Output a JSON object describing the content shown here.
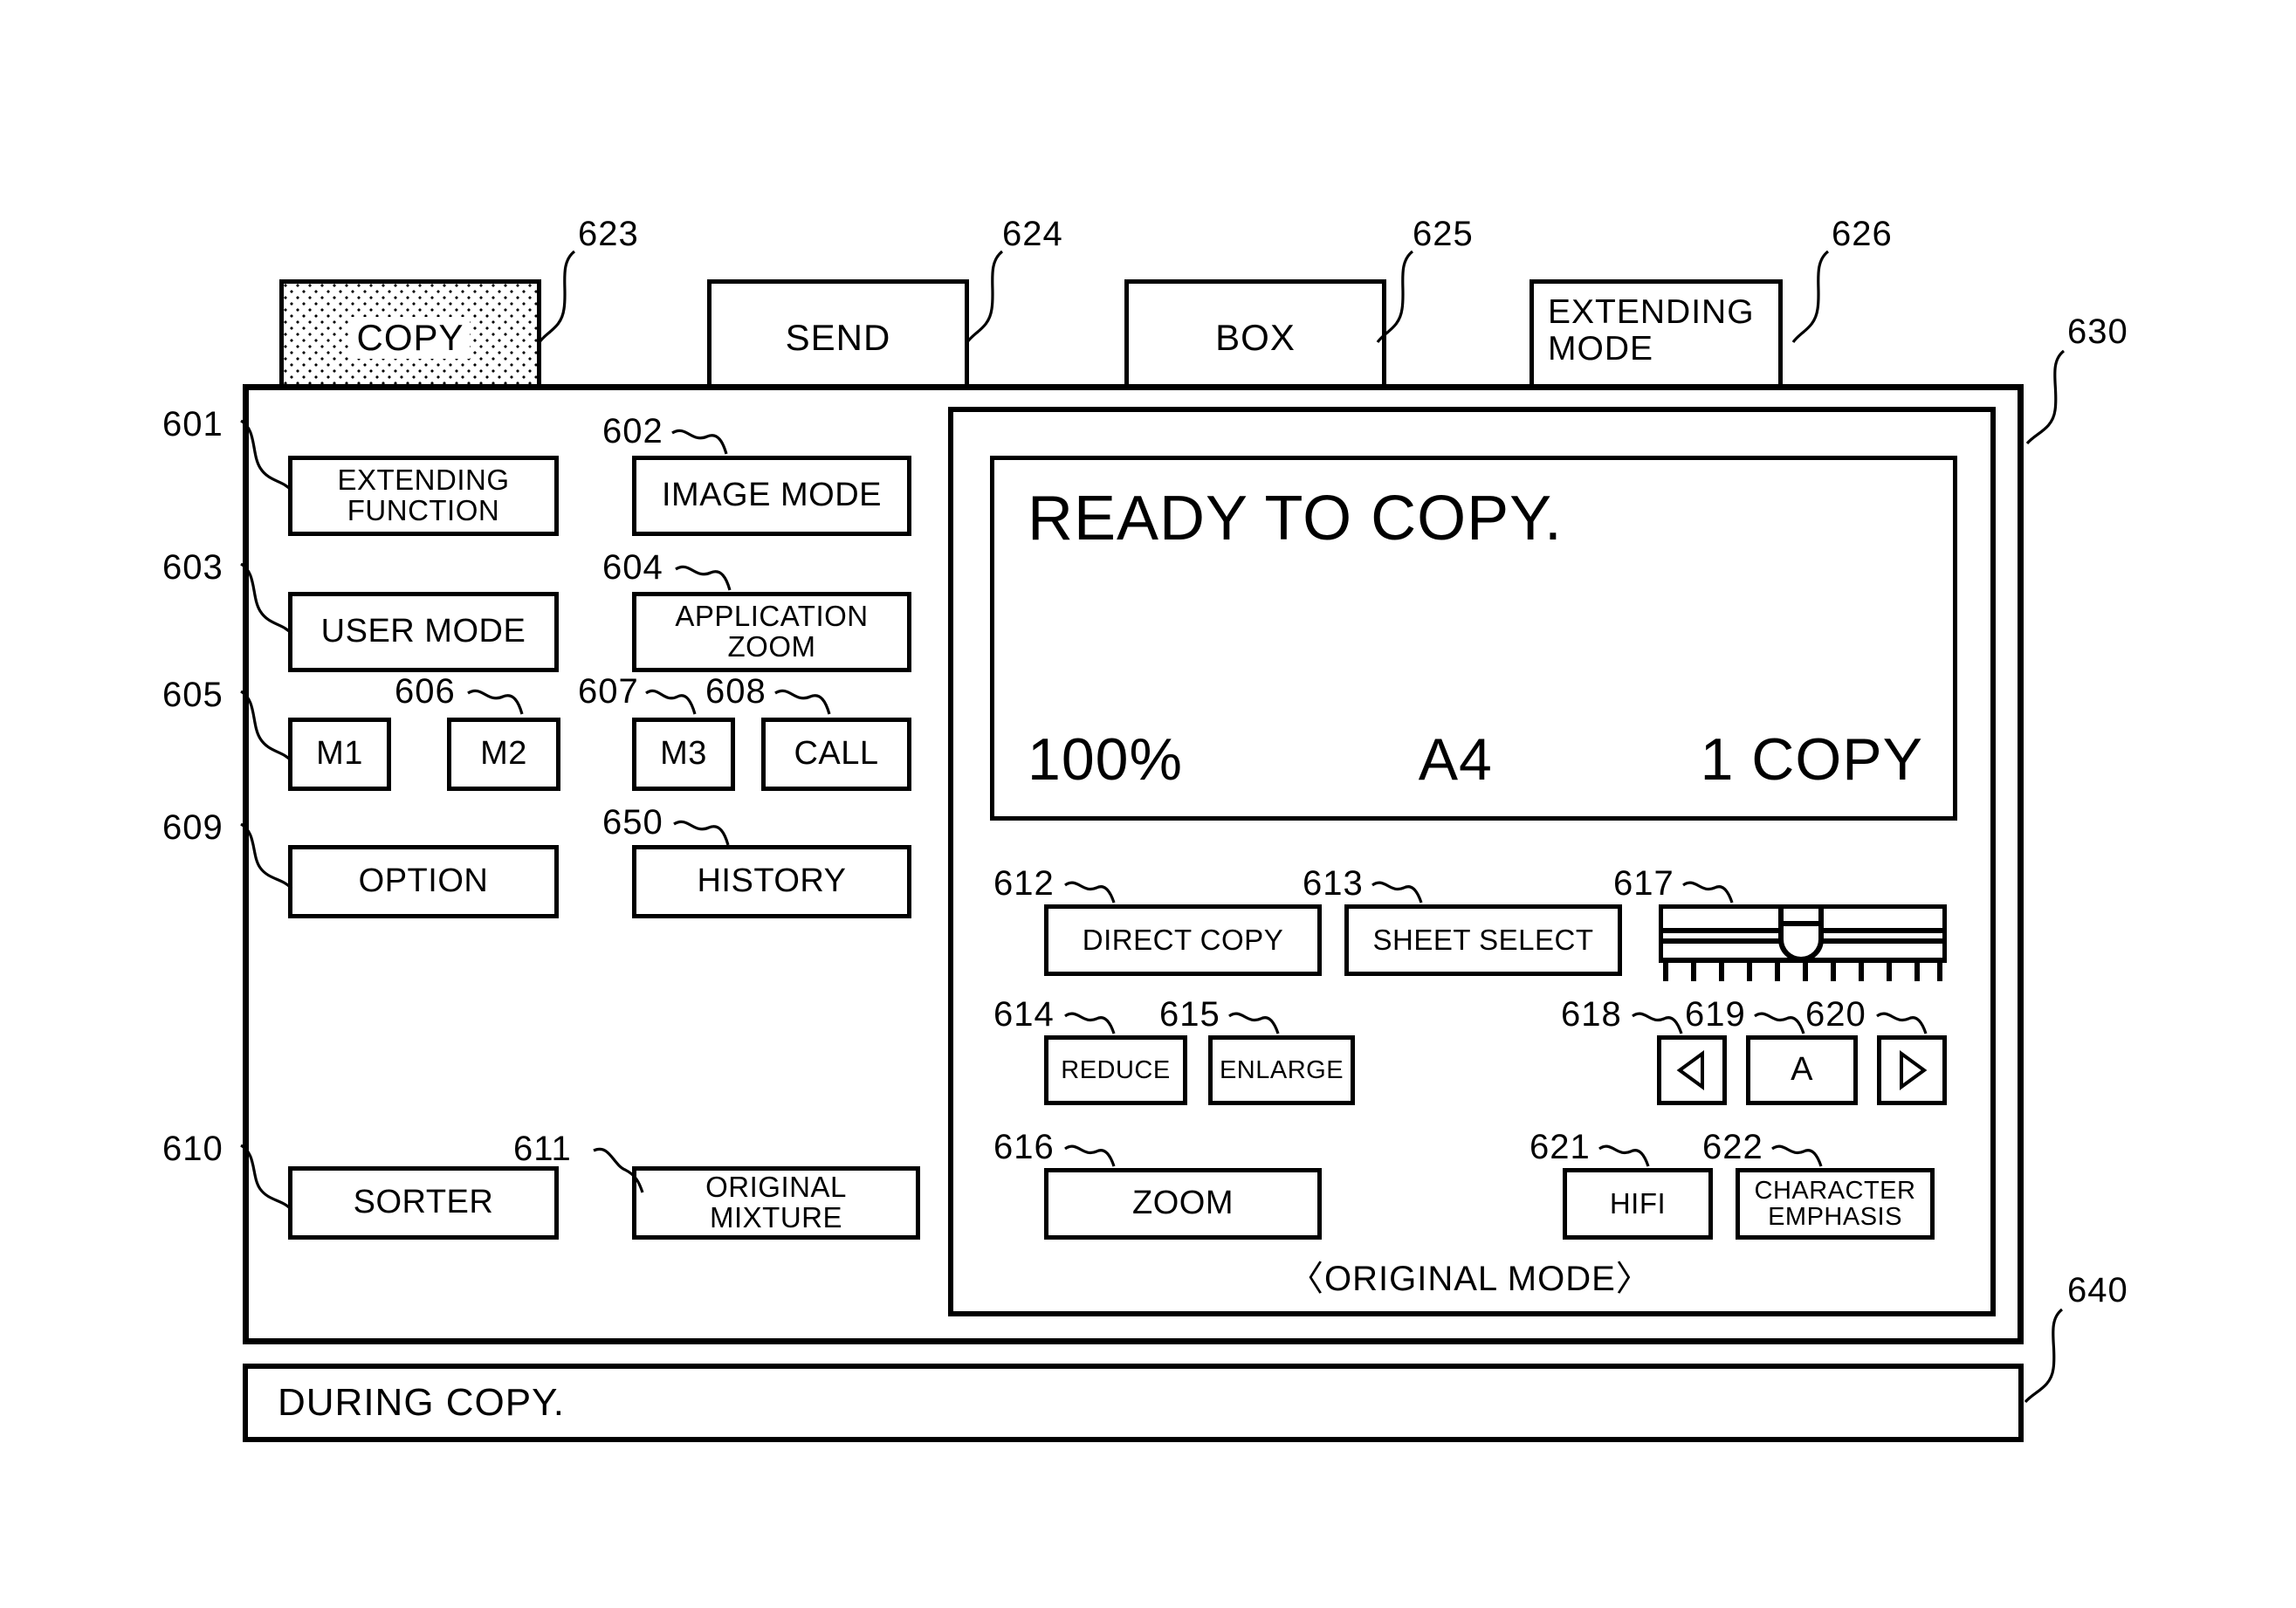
{
  "figure": {
    "kind": "copier-operation-panel-ui",
    "reference_numerals": {
      "extending_function": "601",
      "image_mode": "602",
      "user_mode": "603",
      "application_zoom": "604",
      "m1": "605",
      "m2": "606",
      "m3": "607",
      "call": "608",
      "option": "609",
      "sorter": "610",
      "original_mixture": "611",
      "direct_copy": "612",
      "sheet_select": "613",
      "reduce": "614",
      "enlarge": "615",
      "zoom": "616",
      "density_slider": "617",
      "arrow_left": "618",
      "auto_density": "619",
      "arrow_right": "620",
      "hifi": "621",
      "character_emphasis": "622",
      "tab_copy": "623",
      "tab_send": "624",
      "tab_box": "625",
      "tab_extending_mode": "626",
      "main_panel": "630",
      "status_bar": "640",
      "history": "650"
    }
  },
  "tabs": [
    {
      "id": "copy",
      "label": "COPY",
      "selected": true,
      "ref": "623"
    },
    {
      "id": "send",
      "label": "SEND",
      "selected": false,
      "ref": "624"
    },
    {
      "id": "box",
      "label": "BOX",
      "selected": false,
      "ref": "625"
    },
    {
      "id": "extending-mode",
      "label_line1": "EXTENDING",
      "label_line2": "MODE",
      "selected": false,
      "ref": "626"
    }
  ],
  "left_panel": {
    "buttons": [
      {
        "id": "extending-function",
        "line1": "EXTENDING",
        "line2": "FUNCTION",
        "ref": "601"
      },
      {
        "id": "image-mode",
        "label": "IMAGE MODE",
        "ref": "602"
      },
      {
        "id": "user-mode",
        "label": "USER MODE",
        "ref": "603"
      },
      {
        "id": "application-zoom",
        "label": "APPLICATION ZOOM",
        "ref": "604"
      },
      {
        "id": "m1",
        "label": "M1",
        "ref": "605"
      },
      {
        "id": "m2",
        "label": "M2",
        "ref": "606"
      },
      {
        "id": "m3",
        "label": "M3",
        "ref": "607"
      },
      {
        "id": "call",
        "label": "CALL",
        "ref": "608"
      },
      {
        "id": "option",
        "label": "OPTION",
        "ref": "609"
      },
      {
        "id": "history",
        "label": "HISTORY",
        "ref": "650"
      },
      {
        "id": "sorter",
        "label": "SORTER",
        "ref": "610"
      },
      {
        "id": "original-mixture",
        "label": "ORIGINAL MIXTURE",
        "ref": "611"
      }
    ]
  },
  "display": {
    "message": "READY TO COPY.",
    "zoom_ratio": "100%",
    "paper_size": "A4",
    "copy_count": "1 COPY"
  },
  "right_panel": {
    "buttons": [
      {
        "id": "direct-copy",
        "label": "DIRECT COPY",
        "ref": "612"
      },
      {
        "id": "sheet-select",
        "label": "SHEET SELECT",
        "ref": "613"
      },
      {
        "id": "reduce",
        "label": "REDUCE",
        "ref": "614"
      },
      {
        "id": "enlarge",
        "label": "ENLARGE",
        "ref": "615"
      },
      {
        "id": "zoom",
        "label": "ZOOM",
        "ref": "616"
      },
      {
        "id": "hifi",
        "label": "HIFI",
        "ref": "621"
      },
      {
        "id": "character-emphasis",
        "line1": "CHARACTER",
        "line2": "EMPHASIS",
        "ref": "622"
      }
    ],
    "density": {
      "slider_ref": "617",
      "ticks": 11,
      "thumb_position_percent": 50,
      "arrow_left_ref": "618",
      "arrow_left_glyph": "left-triangle",
      "auto_label": "A",
      "auto_ref": "619",
      "arrow_right_ref": "620",
      "arrow_right_glyph": "right-triangle"
    },
    "caption": "〈ORIGINAL MODE〉"
  },
  "status_bar": {
    "text": "DURING COPY.",
    "ref": "640"
  },
  "colors": {
    "ink": "#000000",
    "paper": "#ffffff"
  }
}
